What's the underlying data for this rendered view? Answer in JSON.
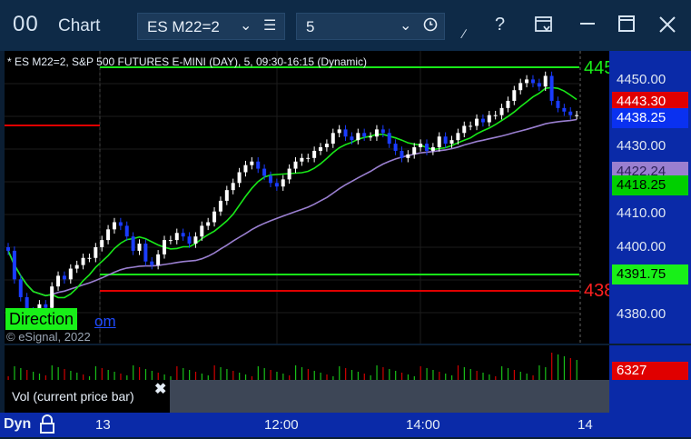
{
  "window": {
    "app_icon_glyph": "00",
    "title": "Chart",
    "symbol": "ES M22=2",
    "interval": "5",
    "icons": [
      "chevron-down-icon",
      "hamburger-menu-icon",
      "clock-icon",
      "draw-tool-icon",
      "help-icon",
      "page-settings-icon",
      "minimize-icon",
      "maximize-icon",
      "close-icon"
    ]
  },
  "chart": {
    "header": "* ES M22=2, S&P 500 FUTURES E-MINI (DAY), 5, 09:30-16:15 (Dynamic)",
    "right_label_top": "445",
    "right_label_bottom": "438",
    "direction_label": "Direction",
    "esignal_link": "om",
    "copyright": "© eSignal, 2022"
  },
  "price_axis": {
    "ticks": [
      "4450.00",
      "4430.00",
      "4410.00",
      "4400.00",
      "4380.00"
    ],
    "markers": [
      {
        "label": "4443.30",
        "bg": "#e00000",
        "fg": "#ffffff"
      },
      {
        "label": "4438.25",
        "bg": "#0a31f0",
        "fg": "#ffffff"
      },
      {
        "label": "4422.24",
        "bg": "#9a7fd0",
        "fg": "#2a1f55"
      },
      {
        "label": "4418.25",
        "bg": "#00d000",
        "fg": "#000000"
      },
      {
        "label": "4391.75",
        "bg": "#18f018",
        "fg": "#000000"
      }
    ]
  },
  "volume": {
    "marker": "6327",
    "marker_bg": "#e00000"
  },
  "tooltip": {
    "text": "Vol (current price bar)",
    "close": "✖"
  },
  "time_axis": {
    "mode": "Dyn",
    "labels": [
      "13",
      "12:00",
      "14:00",
      "14"
    ]
  },
  "colors": {
    "up_candle": "#ffffff",
    "down_candle": "#1a3cff",
    "fast_ma": "#18e818",
    "slow_ma": "#9a7fd0",
    "stop_line": "#e00000",
    "background": "#000000",
    "axis_bg": "#0a2aa8",
    "titlebar": "#0e2a47"
  },
  "chart_data": {
    "type": "candlestick",
    "ylim": [
      4374,
      4456
    ],
    "closes": [
      4400,
      4392,
      4387,
      4383,
      4381,
      4385,
      4384,
      4390,
      4393,
      4392,
      4395,
      4396,
      4398,
      4398,
      4401,
      4403,
      4406,
      4408,
      4407,
      4404,
      4400,
      4402,
      4397,
      4396,
      4399,
      4403,
      4403,
      4405,
      4404,
      4402,
      4404,
      4407,
      4408,
      4411,
      4414,
      4417,
      4419,
      4422,
      4424,
      4425,
      4423,
      4421,
      4419,
      4418,
      4420,
      4423,
      4425,
      4426,
      4426,
      4428,
      4429,
      4430,
      4433,
      4434,
      4432,
      4431,
      4433,
      4432,
      4432,
      4434,
      4433,
      4430,
      4428,
      4426,
      4427,
      4429,
      4430,
      4428,
      4429,
      4432,
      4430,
      4431,
      4433,
      4435,
      4435,
      4437,
      4436,
      4438,
      4438,
      4440,
      4442,
      4445,
      4447,
      4448,
      4447,
      4446,
      4449,
      4442,
      4440,
      4439,
      4438,
      4438
    ]
  }
}
